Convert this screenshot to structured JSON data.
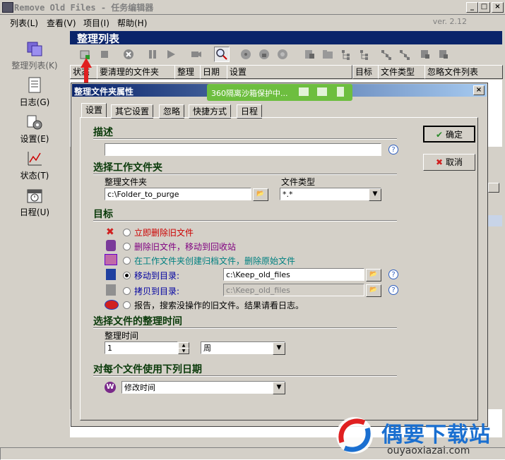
{
  "window": {
    "title": "Remove Old Files - 任务编辑器",
    "version": "ver. 2.12"
  },
  "menu": [
    "列表(L)",
    "查看(V)",
    "项目(I)",
    "帮助(H)"
  ],
  "nav": [
    {
      "label": "整理列表(K)",
      "icon": "list-icon"
    },
    {
      "label": "日志(G)",
      "icon": "log-icon"
    },
    {
      "label": "设置(E)",
      "icon": "settings-icon"
    },
    {
      "label": "状态(T)",
      "icon": "status-icon"
    },
    {
      "label": "日程(U)",
      "icon": "schedule-icon"
    }
  ],
  "panel": {
    "title": "整理列表"
  },
  "list_columns": [
    "状态",
    "要清理的文件夹",
    "整理",
    "日期",
    "设置",
    "目标",
    "文件类型",
    "忽略文件列表"
  ],
  "dialog": {
    "title": "整理文件夹属性",
    "sandbox": "360隔离沙箱保护中...",
    "tabs": [
      "设置",
      "其它设置",
      "忽略",
      "快捷方式",
      "日程"
    ],
    "active_tab": "设置",
    "ok": "确定",
    "cancel": "取消",
    "sections": {
      "desc": "描述",
      "workdir": "选择工作文件夹",
      "target": "目标",
      "time": "选择文件的整理时间",
      "date": "对每个文件使用下列日期"
    },
    "description_value": "",
    "folder_label": "整理文件夹",
    "folder_value": "c:\\Folder_to_purge",
    "type_label": "文件类型",
    "type_value": "*.*",
    "options": [
      {
        "label": "立即删除旧文件",
        "color": "#cc0000",
        "selected": false
      },
      {
        "label": "删除旧文件，移动到回收站",
        "color": "#800080",
        "selected": false
      },
      {
        "label": "在工作文件夹创建归档文件，删除原始文件",
        "color": "#008080",
        "selected": false
      },
      {
        "label": "移动到目录:",
        "color": "#0000a0",
        "selected": true
      },
      {
        "label": "拷贝到目录:",
        "color": "#0000a0",
        "selected": false
      },
      {
        "label": "报告，搜索没操作的旧文件。结果请看日志。",
        "color": "#000000",
        "selected": false
      }
    ],
    "move_path": "c:\\Keep_old_files",
    "copy_path": "c:\\Keep_old_files",
    "time_label": "整理时间",
    "time_value": "1",
    "time_unit": "周",
    "date_value": "修改时间"
  },
  "watermark": {
    "brand": "偶要下载站",
    "url": "ouyaoxiazai.com"
  }
}
